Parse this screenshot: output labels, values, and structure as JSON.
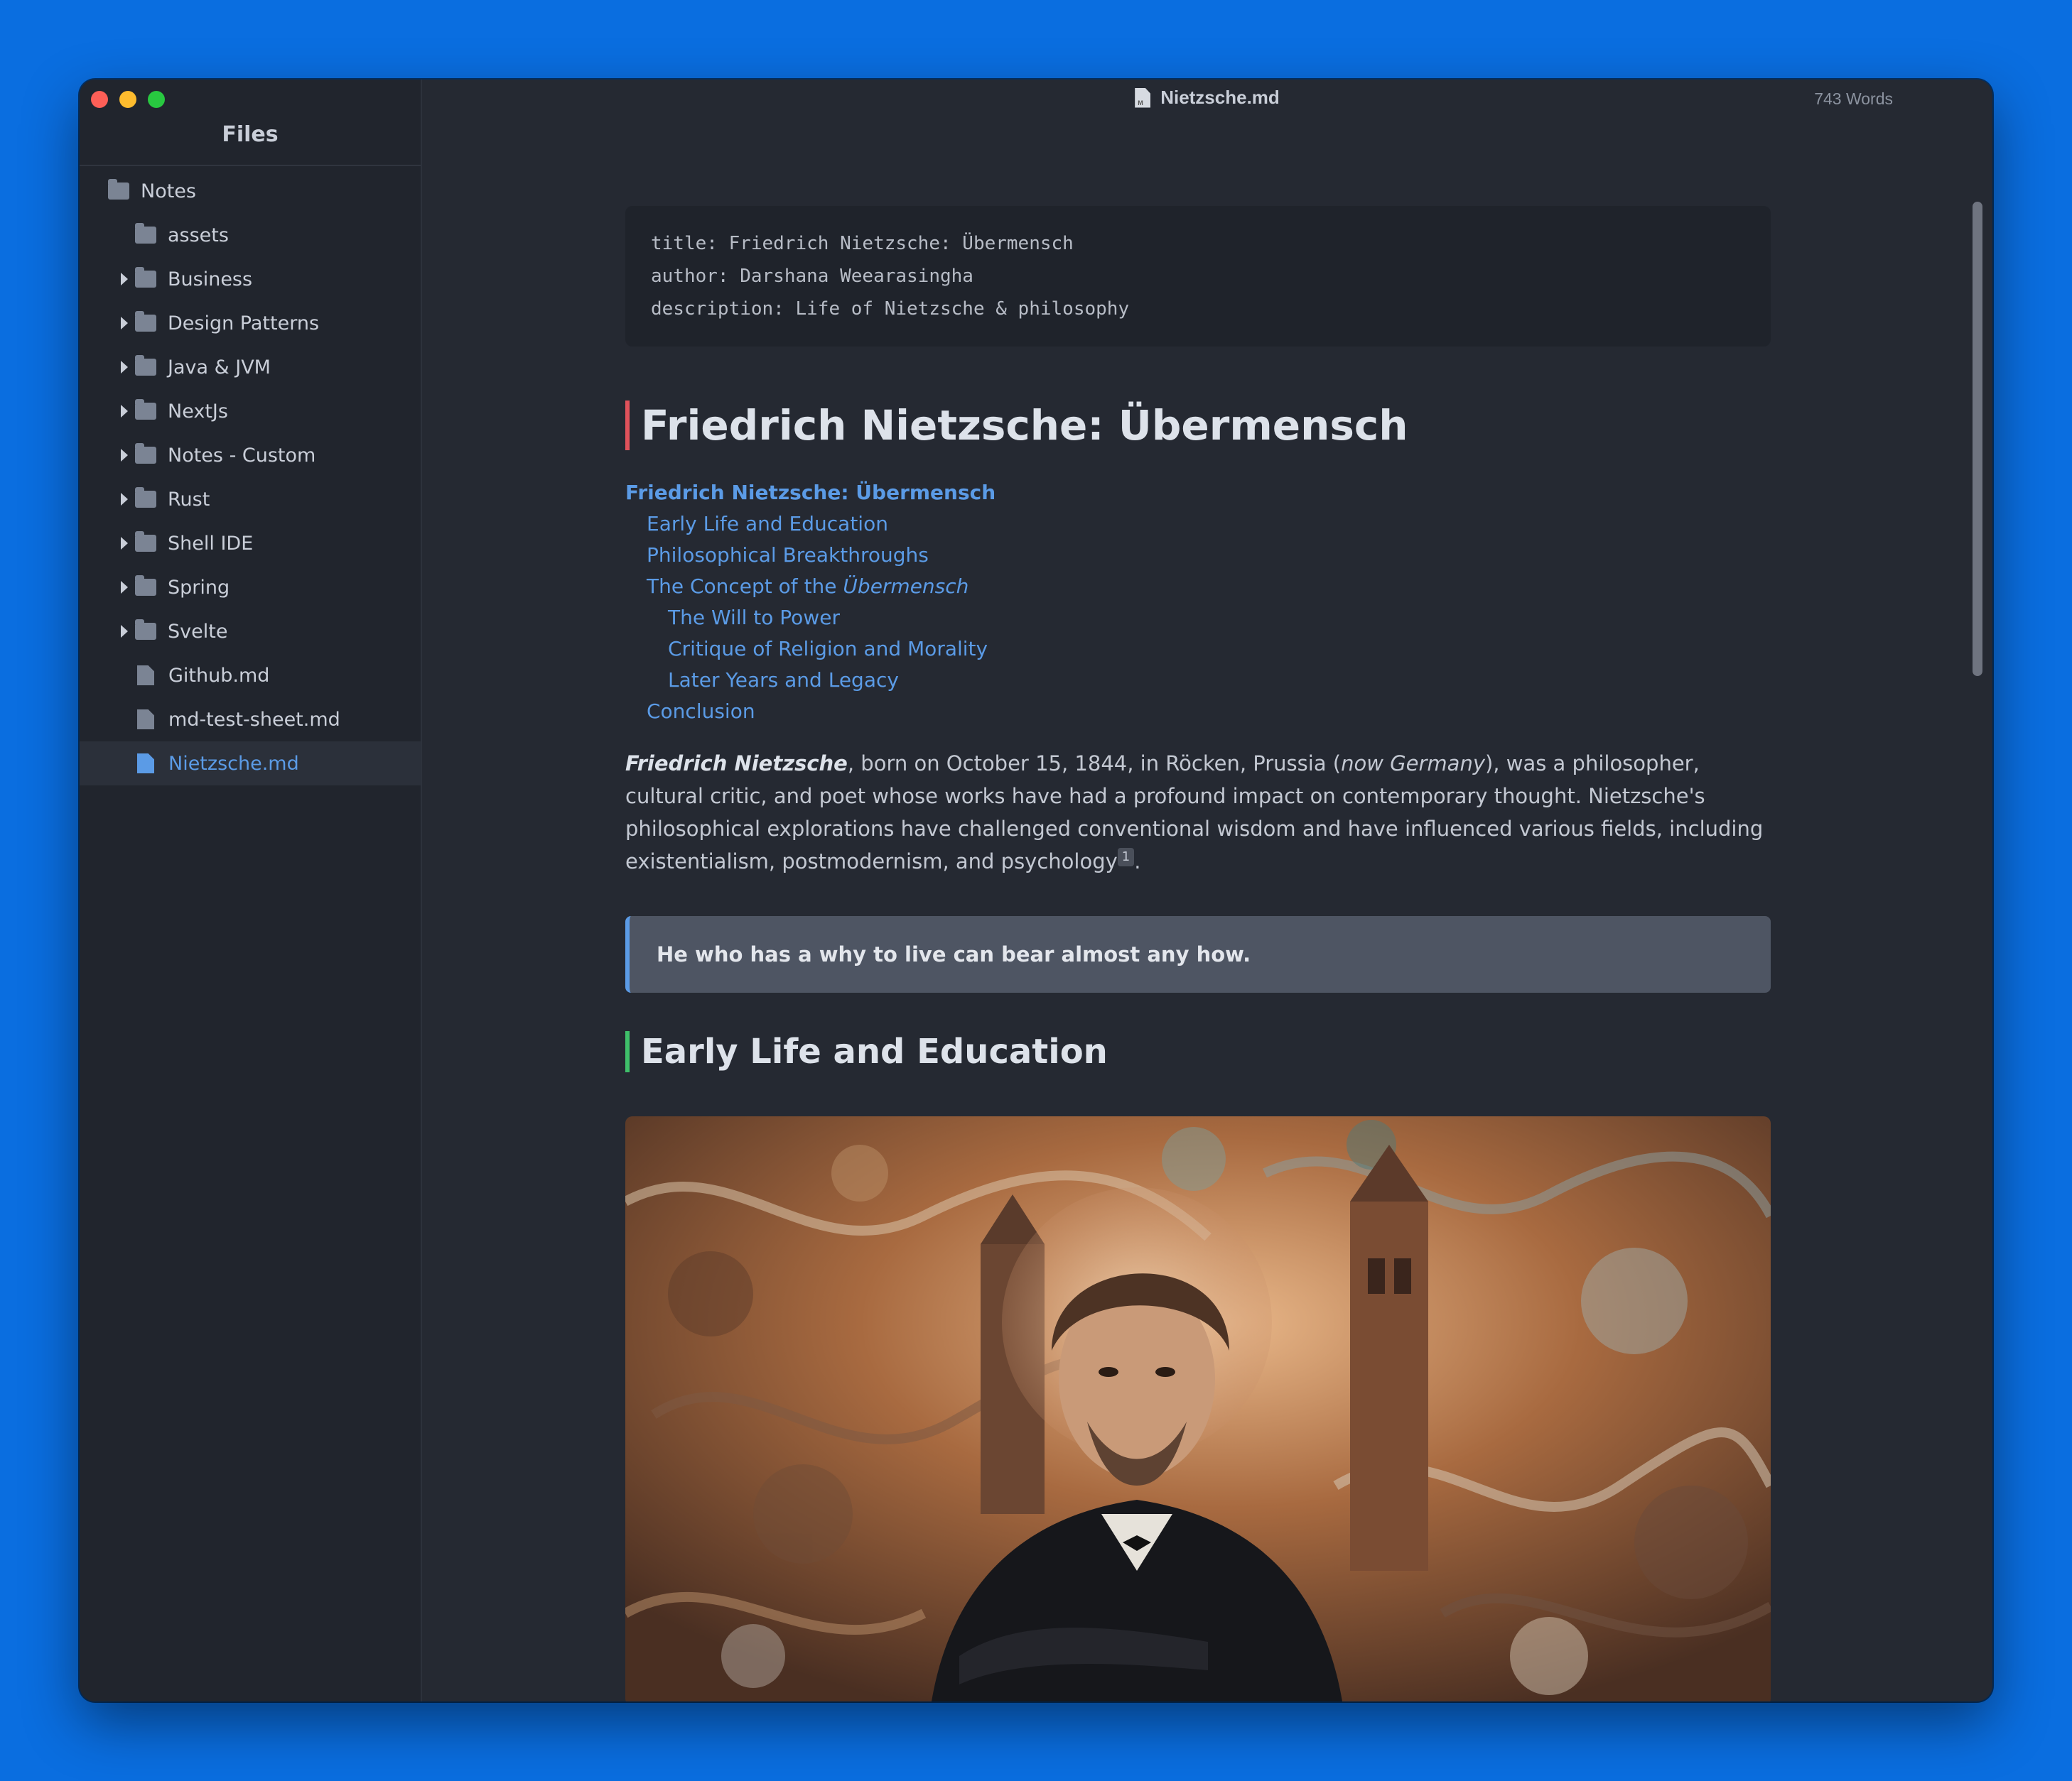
{
  "window": {
    "doc_title": "Nietzsche.md",
    "word_count": "743 Words"
  },
  "sidebar": {
    "title": "Files",
    "items": [
      {
        "label": "Notes",
        "type": "folder",
        "level": 0,
        "expandable": false
      },
      {
        "label": "assets",
        "type": "folder",
        "level": 1,
        "expandable": false
      },
      {
        "label": "Business",
        "type": "folder",
        "level": 1,
        "expandable": true
      },
      {
        "label": "Design Patterns",
        "type": "folder",
        "level": 1,
        "expandable": true
      },
      {
        "label": "Java & JVM",
        "type": "folder",
        "level": 1,
        "expandable": true
      },
      {
        "label": "NextJs",
        "type": "folder",
        "level": 1,
        "expandable": true
      },
      {
        "label": "Notes - Custom",
        "type": "folder",
        "level": 1,
        "expandable": true
      },
      {
        "label": "Rust",
        "type": "folder",
        "level": 1,
        "expandable": true
      },
      {
        "label": "Shell IDE",
        "type": "folder",
        "level": 1,
        "expandable": true
      },
      {
        "label": "Spring",
        "type": "folder",
        "level": 1,
        "expandable": true
      },
      {
        "label": "Svelte",
        "type": "folder",
        "level": 1,
        "expandable": true
      },
      {
        "label": "Github.md",
        "type": "file",
        "level": 1,
        "expandable": false
      },
      {
        "label": "md-test-sheet.md",
        "type": "file",
        "level": 1,
        "expandable": false
      },
      {
        "label": "Nietzsche.md",
        "type": "file",
        "level": 1,
        "expandable": false,
        "selected": true
      }
    ]
  },
  "document": {
    "frontmatter": [
      "title: Friedrich Nietzsche: Übermensch",
      "author: Darshana Weearasingha",
      "description: Life of Nietzsche & philosophy"
    ],
    "h1": "Friedrich Nietzsche: Übermensch",
    "toc": [
      {
        "label": "Friedrich Nietzsche: Übermensch",
        "level": 0
      },
      {
        "label": "Early Life and Education",
        "level": 1
      },
      {
        "label": "Philosophical Breakthroughs",
        "level": 1
      },
      {
        "label_prefix": "The Concept of the ",
        "label_em": "Übermensch",
        "level": 1
      },
      {
        "label": "The Will to Power",
        "level": 2
      },
      {
        "label": "Critique of Religion and Morality",
        "level": 2
      },
      {
        "label": "Later Years and Legacy",
        "level": 2
      },
      {
        "label": "Conclusion",
        "level": 1
      }
    ],
    "intro": {
      "name": "Friedrich Nietzsche",
      "part1": ", born on October 15, 1844, in Röcken, Prussia (",
      "country": "now Germany",
      "part2": "), was a philosopher, cultural critic, and poet whose works have had a profound impact on contemporary thought. Nietzsche's philosophical explorations have challenged conventional wisdom and have influenced various fields, including existentialism, postmodernism, and psychology",
      "footnote": "1",
      "end": "."
    },
    "quote": "He who has a why to live can bear almost any how.",
    "h2": "Early Life and Education",
    "image_alt": "Painted portrait of Friedrich Nietzsche with arms crossed, surrounded by surreal faces, towers and swirling forms"
  },
  "colors": {
    "desktop": "#0a6ee0",
    "editor_bg": "#252932",
    "sidebar_bg": "#21252d",
    "link": "#5b9be6",
    "h1_bar": "#e0525b",
    "h2_bar": "#3fbf6a",
    "quote_bg": "#4e5563"
  }
}
